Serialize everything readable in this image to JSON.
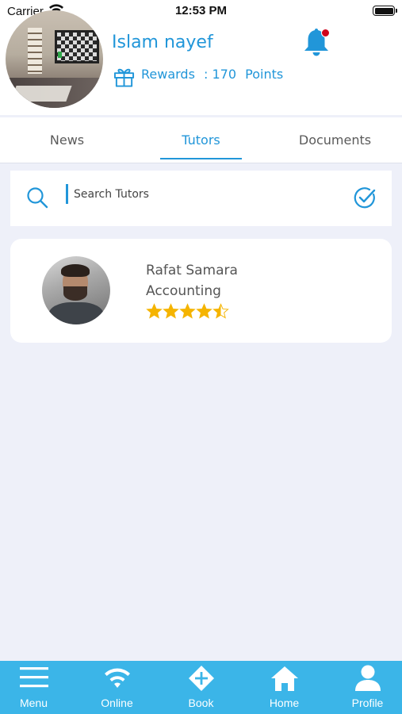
{
  "status_bar": {
    "carrier": "Carrier",
    "time": "12:53 PM"
  },
  "header": {
    "user_name": "Islam nayef",
    "rewards_label": "Rewards",
    "rewards_value": ": 170",
    "rewards_unit": "Points",
    "notification_dot": true
  },
  "tabs": [
    {
      "label": "News",
      "active": false
    },
    {
      "label": "Tutors",
      "active": true
    },
    {
      "label": "Documents",
      "active": false
    }
  ],
  "search": {
    "placeholder": "Search Tutors",
    "value": ""
  },
  "tutors": [
    {
      "name": "Rafat Samara",
      "subject": "Accounting",
      "rating": 4.5,
      "max_rating": 5
    }
  ],
  "bottom_nav": [
    {
      "label": "Menu",
      "icon": "menu-icon"
    },
    {
      "label": "Online",
      "icon": "wifi-icon"
    },
    {
      "label": "Book",
      "icon": "book-diamond-icon"
    },
    {
      "label": "Home",
      "icon": "home-icon"
    },
    {
      "label": "Profile",
      "icon": "profile-icon"
    }
  ],
  "colors": {
    "accent": "#2196d9",
    "nav_background": "#3bb5e8",
    "page_background": "#eef0f9",
    "star": "#f5b400",
    "notification": "#d0021b"
  }
}
